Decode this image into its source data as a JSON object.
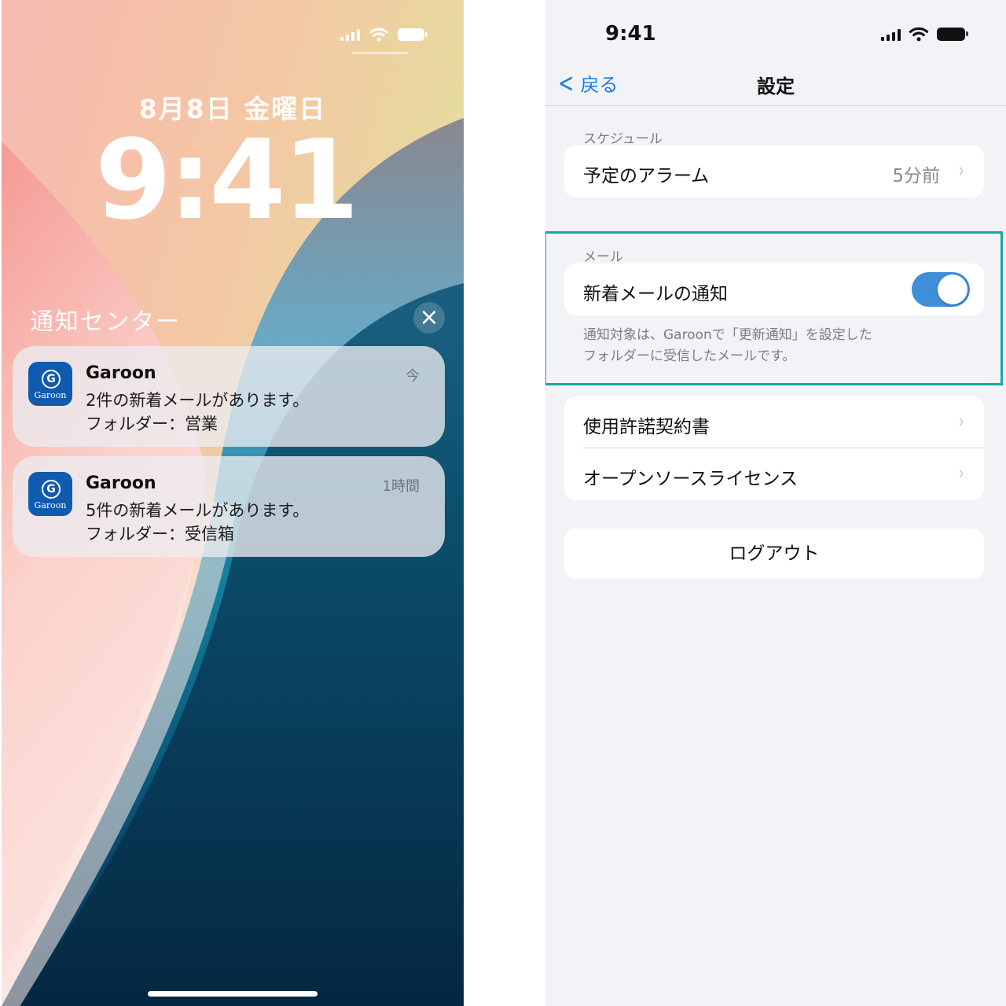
{
  "lock_screen": {
    "date": "8月8日 金曜日",
    "time": "9:41",
    "notification_center_title": "通知センター",
    "close_glyph": "×",
    "notifications": [
      {
        "app": "Garoon",
        "icon_letter": "G",
        "icon_text": "Garoon",
        "time": "今",
        "line1": "2件の新着メールがあります。",
        "line2": "フォルダー：営業"
      },
      {
        "app": "Garoon",
        "icon_letter": "G",
        "icon_text": "Garoon",
        "time": "1時間",
        "line1": "5件の新着メールがあります。",
        "line2": "フォルダー：受信箱"
      }
    ],
    "status_icons": [
      "signal-icon",
      "wifi-icon",
      "battery-icon"
    ]
  },
  "settings": {
    "status_time": "9:41",
    "back_label": "戻る",
    "title": "設定",
    "schedule_header": "スケジュール",
    "alarm_label": "予定のアラーム",
    "alarm_value": "5分前",
    "mail_header": "メール",
    "new_mail_label": "新着メールの通知",
    "new_mail_enabled": true,
    "footnote_line1": "通知対象は、Garoonで「更新通知」を設定した",
    "footnote_line2": "フォルダーに受信したメールです。",
    "license_label": "使用許諾契約書",
    "oss_label": "オープンソースライセンス",
    "logout_label": "ログアウト",
    "chevron_glyph": "›",
    "highlight_color": "#13a89e",
    "accent_color": "#1a7ee6"
  }
}
